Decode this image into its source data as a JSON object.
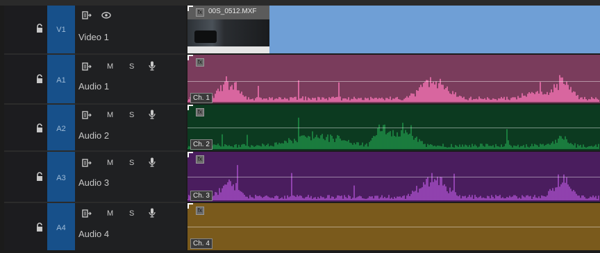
{
  "colors": {
    "video": "#6f9fd6",
    "audio1": "#7a3c5c",
    "audio1_wave": "#f071b0",
    "audio2": "#0c3a20",
    "audio2_wave": "#1e8c45",
    "audio3": "#4a1d5e",
    "audio3_wave": "#a24bc2",
    "audio4": "#7a5a1c",
    "target": "#17508a"
  },
  "tracks": [
    {
      "id": "V1",
      "name": "Video 1",
      "kind": "video",
      "controls": [
        "sync-lock-icon",
        "eye-icon"
      ]
    },
    {
      "id": "A1",
      "name": "Audio 1",
      "kind": "audio",
      "controls": {
        "solo_label": "S",
        "mute_label": "M"
      },
      "clip": {
        "channel_label": "Ch. 1"
      }
    },
    {
      "id": "A2",
      "name": "Audio 2",
      "kind": "audio",
      "controls": {
        "solo_label": "S",
        "mute_label": "M"
      },
      "clip": {
        "channel_label": "Ch. 2"
      }
    },
    {
      "id": "A3",
      "name": "Audio 3",
      "kind": "audio",
      "controls": {
        "solo_label": "S",
        "mute_label": "M"
      },
      "clip": {
        "channel_label": "Ch. 3"
      }
    },
    {
      "id": "A4",
      "name": "Audio 4",
      "kind": "audio",
      "controls": {
        "solo_label": "S",
        "mute_label": "M"
      },
      "clip": {
        "channel_label": "Ch. 4"
      }
    }
  ],
  "video_clip": {
    "name": "00S_0512.MXF",
    "fx_label": "fx"
  },
  "icons": {
    "lock": "lock-icon",
    "sync": "sync-lock-icon",
    "eye": "eye-icon",
    "mic": "microphone-icon",
    "fx": "fx-badge-icon"
  }
}
